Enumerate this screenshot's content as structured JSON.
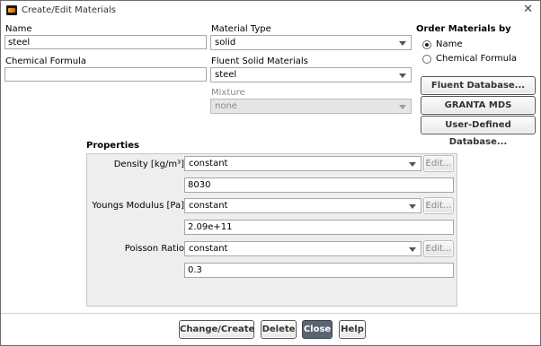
{
  "window": {
    "title": "Create/Edit Materials"
  },
  "name": {
    "label": "Name",
    "value": "steel"
  },
  "chemical_formula": {
    "label": "Chemical Formula",
    "value": ""
  },
  "material_type": {
    "label": "Material Type",
    "value": "solid"
  },
  "fluent_solid_materials": {
    "label": "Fluent Solid Materials",
    "value": "steel"
  },
  "mixture": {
    "label": "Mixture",
    "value": "none"
  },
  "order_by": {
    "label": "Order Materials by",
    "options": [
      {
        "label": "Name",
        "selected": true
      },
      {
        "label": "Chemical Formula",
        "selected": false
      }
    ]
  },
  "database_buttons": {
    "fluent": "Fluent Database...",
    "granta": "GRANTA MDS Database...",
    "user_defined": "User-Defined Database..."
  },
  "properties": {
    "title": "Properties",
    "items": [
      {
        "label": "Density [kg/m³]",
        "method": "constant",
        "edit": "Edit...",
        "value": "8030"
      },
      {
        "label": "Youngs Modulus [Pa]",
        "method": "constant",
        "edit": "Edit...",
        "value": "2.09e+11"
      },
      {
        "label": "Poisson Ratio",
        "method": "constant",
        "edit": "Edit...",
        "value": "0.3"
      }
    ]
  },
  "footer": {
    "change_create": "Change/Create",
    "delete": "Delete",
    "close": "Close",
    "help": "Help"
  }
}
